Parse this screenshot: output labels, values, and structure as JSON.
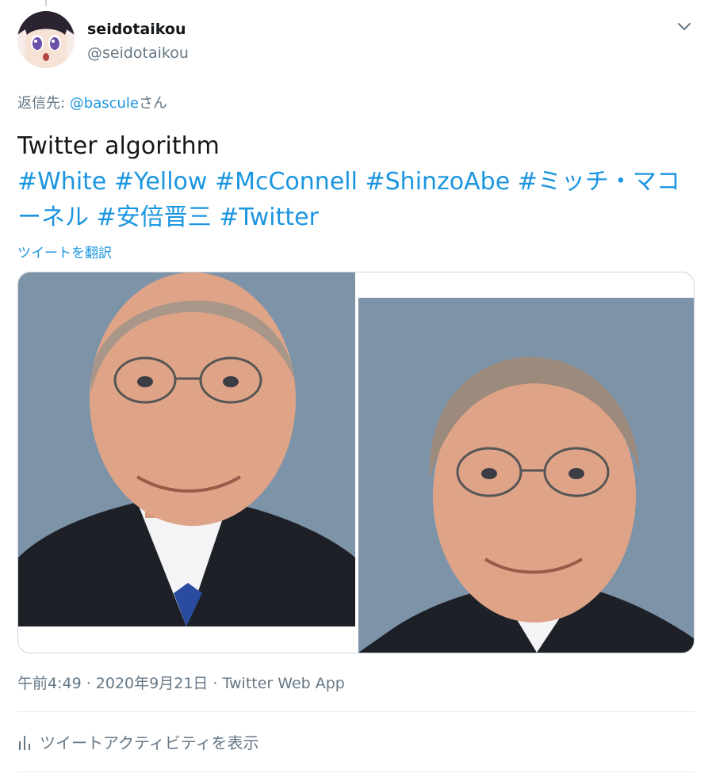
{
  "author": {
    "display_name": "seidotaikou",
    "handle": "@seidotaikou"
  },
  "reply": {
    "prefix": "返信先: ",
    "mention": "@bascule",
    "suffix": "さん"
  },
  "tweet": {
    "text_line": "Twitter algorithm",
    "hashtags": [
      "#White",
      "#Yellow",
      "#McConnell",
      "#ShinzoAbe",
      "#ミッチ・マコーネル",
      "#安倍晋三",
      "#Twitter"
    ]
  },
  "translate_label": "ツイートを翻訳",
  "meta": {
    "time": "午前4:49",
    "separator": " · ",
    "date": "2020年9月21日",
    "source": "Twitter Web App"
  },
  "activity_label": "ツイートアクティビティを表示",
  "icons": {
    "menu": "chevron-down-icon",
    "activity": "bar-chart-icon"
  },
  "colors": {
    "link": "#1b95e0",
    "secondary": "#657786",
    "divider": "#e6ecf0"
  }
}
